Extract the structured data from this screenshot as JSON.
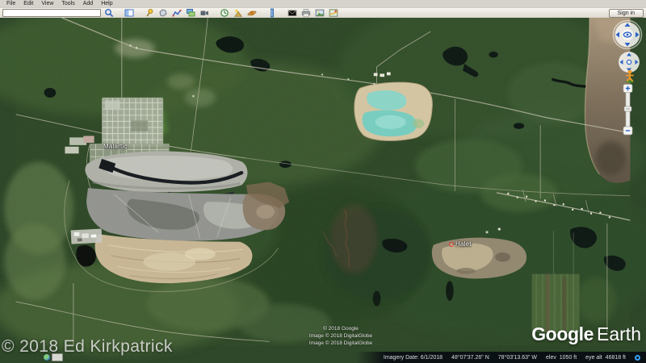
{
  "menu": {
    "items": [
      "File",
      "Edit",
      "View",
      "Tools",
      "Add",
      "Help"
    ]
  },
  "toolbar": {
    "search_value": "",
    "signin_label": "Sign in",
    "buttons": [
      {
        "name": "search-icon"
      },
      {
        "name": "sidebar-icon"
      },
      {
        "name": "placemark-icon"
      },
      {
        "name": "polygon-icon"
      },
      {
        "name": "path-icon"
      },
      {
        "name": "image-overlay-icon"
      },
      {
        "name": "record-tour-icon"
      },
      {
        "name": "historical-imagery-icon"
      },
      {
        "name": "sunlight-icon"
      },
      {
        "name": "planets-icon"
      },
      {
        "name": "ruler-icon"
      },
      {
        "name": "email-icon"
      },
      {
        "name": "print-icon"
      },
      {
        "name": "save-image-icon"
      },
      {
        "name": "maps-icon"
      }
    ]
  },
  "map": {
    "label_malartic": "Malartic",
    "label_halet": "Halet",
    "attribution": {
      "line1": "© 2018 Google",
      "line2": "Image © 2018 DigitalGlobe",
      "line3": "Image © 2018 DigitalGlobe"
    },
    "user_copyright": "© 2018 Ed Kirkpatrick",
    "watermark_google": "Google",
    "watermark_earth": "Earth"
  },
  "statusbar": {
    "imagery_date": "Imagery Date: 6/1/2018",
    "latitude": "48°07'37.26\" N",
    "longitude": "78°03'13.63\" W",
    "elevation": "elev  1050 ft",
    "eye_altitude": "eye alt  46818 ft"
  },
  "colors": {
    "accent_blue": "#2a62c4",
    "status_spinner": "#38a3f4",
    "pond_turquoise": "#7fd2c5",
    "mine_gray": "#939490",
    "tailings_tan": "#c9b795",
    "forest_green": "#2c4527"
  }
}
